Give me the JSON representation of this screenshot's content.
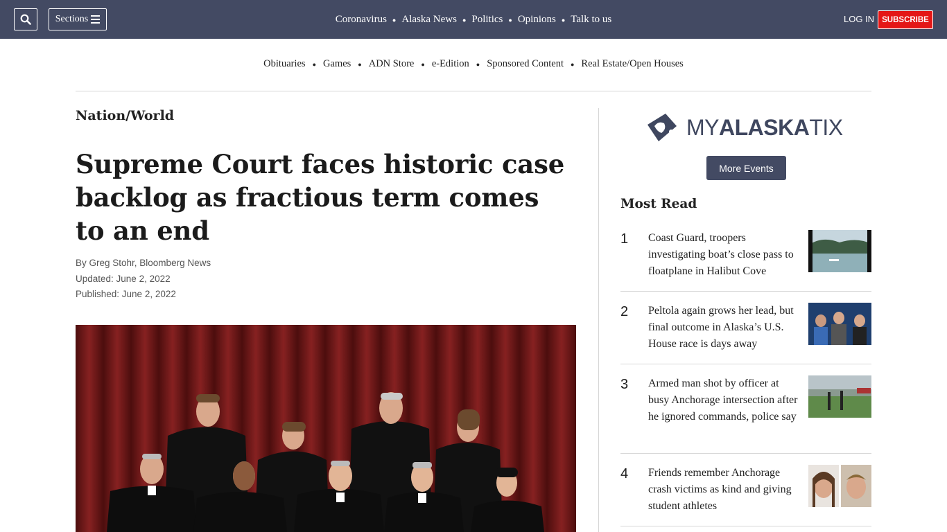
{
  "header": {
    "sections_label": "Sections",
    "nav": [
      "Coronavirus",
      "Alaska News",
      "Politics",
      "Opinions",
      "Talk to us"
    ],
    "login_label": "LOG IN",
    "subscribe_label": "SUBSCRIBE",
    "bar_color": "#434a63",
    "subscribe_color": "#e41616"
  },
  "subnav": [
    "Obituaries",
    "Games",
    "ADN Store",
    "e-Edition",
    "Sponsored Content",
    "Real Estate/Open Houses"
  ],
  "article": {
    "section": "Nation/World",
    "headline": "Supreme Court faces historic case backlog as fractious term comes to an end",
    "byline": "By Greg Stohr, Bloomberg News",
    "updated": "Updated: June 2, 2022",
    "published": "Published: June 2, 2022"
  },
  "sidebar": {
    "logo_light": "MY",
    "logo_bold": "ALASKA",
    "logo_end": "TIX",
    "more_events_label": "More Events",
    "most_read_title": "Most Read",
    "most_read": [
      {
        "rank": "1",
        "title": "Coast Guard, troopers investigating boat’s close pass to floatplane in Halibut Cove"
      },
      {
        "rank": "2",
        "title": "Peltola again grows her lead, but final outcome in Alaska’s U.S. House race is days away"
      },
      {
        "rank": "3",
        "title": "Armed man shot by officer at busy Anchorage intersection after he ignored commands, police say"
      },
      {
        "rank": "4",
        "title": "Friends remember Anchorage crash victims as kind and giving student athletes"
      }
    ]
  }
}
